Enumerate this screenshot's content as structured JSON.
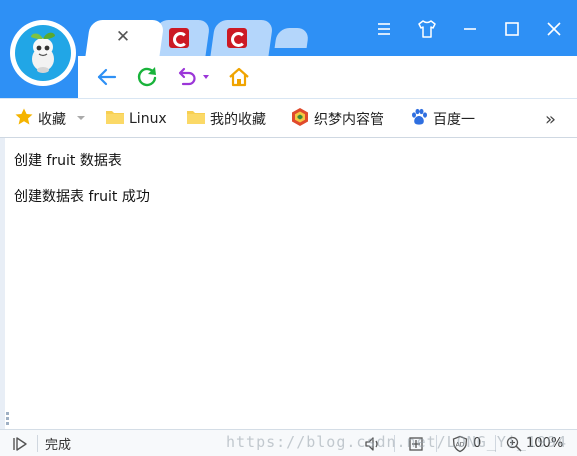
{
  "tabs": [
    {
      "label": "",
      "active": true
    },
    {
      "label": "",
      "active": false
    },
    {
      "label": "",
      "active": false
    }
  ],
  "bookmarks": {
    "favorites_label": "收藏",
    "items": [
      {
        "label": "Linux",
        "icon": "folder-icon"
      },
      {
        "label": "我的收藏",
        "icon": "folder-icon"
      },
      {
        "label": "织梦内容管",
        "icon": "dedecms-icon"
      },
      {
        "label": "百度一",
        "icon": "baidu-paw-icon"
      }
    ],
    "more_label": "»"
  },
  "content": {
    "line1": "创建 fruit 数据表",
    "line2": "创建数据表 fruit 成功"
  },
  "status": {
    "text": "完成",
    "ad_count": "0",
    "zoom": "100%",
    "watermark": "https://blog.csdn.net/LONG_Yi_1994"
  },
  "colors": {
    "titlebar": "#2e90f5",
    "back_arrow": "#2e90f5",
    "refresh": "#19b33b",
    "undo": "#9b36d8",
    "home": "#f0a400",
    "favorite_star": "#f5b400",
    "folder": "#f7cf52"
  }
}
